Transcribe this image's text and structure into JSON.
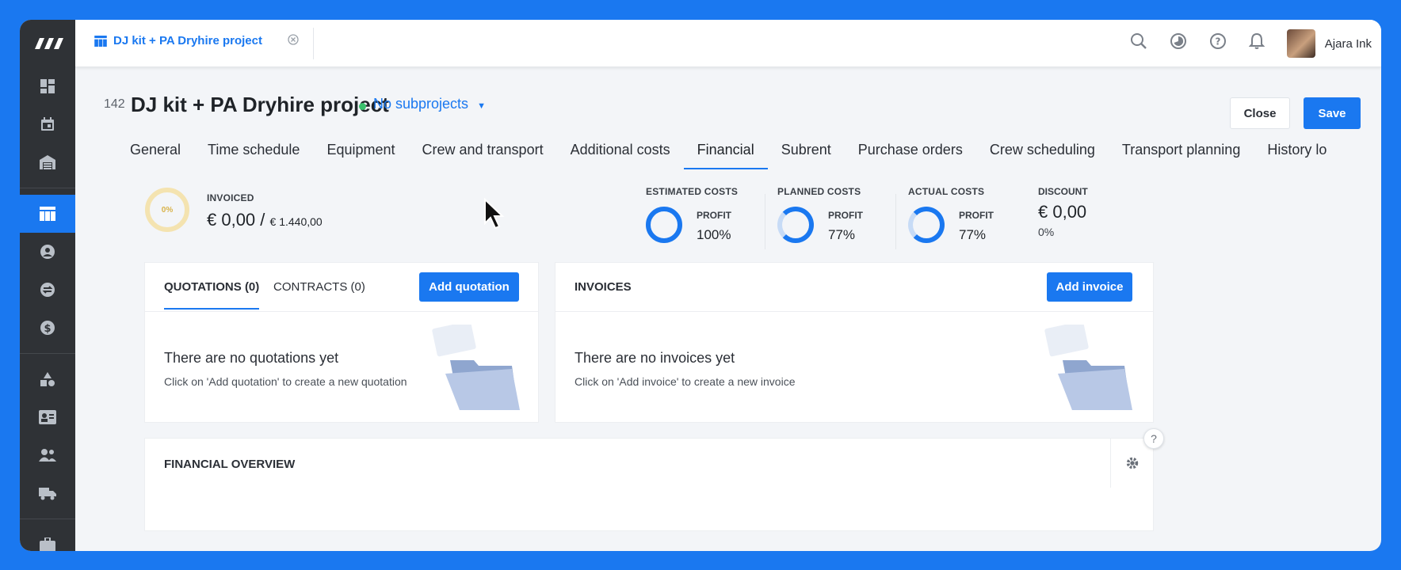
{
  "topbar": {
    "tab_title": "DJ kit + PA Dryhire project",
    "tab_close_icon": "circle-x-icon",
    "user_name": "Ajara Ink",
    "icons": [
      "search-icon",
      "timer-icon",
      "help-icon",
      "bell-icon"
    ]
  },
  "rail": {
    "items": [
      "dashboard-icon",
      "calendar-icon",
      "warehouse-icon",
      "projects-icon",
      "contacts-icon",
      "exchange-icon",
      "finance-icon",
      "shapes-icon",
      "vcard-icon",
      "crew-icon",
      "truck-icon",
      "briefcase-icon"
    ],
    "active": "projects-icon"
  },
  "project": {
    "number": "142",
    "title": "DJ kit + PA Dryhire project",
    "subprojects": "No subprojects",
    "close_label": "Close",
    "save_label": "Save",
    "tabs": [
      "General",
      "Time schedule",
      "Equipment",
      "Crew and transport",
      "Additional costs",
      "Financial",
      "Subrent",
      "Purchase orders",
      "Crew scheduling",
      "Transport planning",
      "History lo"
    ],
    "active_tab": "Financial"
  },
  "summary": {
    "invoiced_pct": "0%",
    "invoiced_label": "INVOICED",
    "invoiced_amount": "€ 0,00 / ",
    "invoiced_total": "€ 1.440,00",
    "estimated": {
      "label": "ESTIMATED COSTS",
      "profit_label": "PROFIT",
      "profit": "100%"
    },
    "planned": {
      "label": "PLANNED COSTS",
      "profit_label": "PROFIT",
      "profit": "77%"
    },
    "actual": {
      "label": "ACTUAL COSTS",
      "profit_label": "PROFIT",
      "profit": "77%"
    },
    "discount": {
      "label": "DISCOUNT",
      "amount": "€ 0,00",
      "pct": "0%"
    }
  },
  "quotations": {
    "tab_quotations": "QUOTATIONS (0)",
    "tab_contracts": "CONTRACTS (0)",
    "add_label": "Add quotation",
    "empty_title": "There are no quotations yet",
    "empty_sub": "Click on 'Add quotation' to create a new quotation"
  },
  "invoices": {
    "title": "INVOICES",
    "add_label": "Add invoice",
    "empty_title": "There are no invoices yet",
    "empty_sub": "Click on 'Add invoice' to create a new invoice"
  },
  "overview": {
    "title": "FINANCIAL OVERVIEW"
  },
  "colors": {
    "accent": "#1a78f0",
    "rail": "#2f3236",
    "status_green": "#3ac06c"
  }
}
